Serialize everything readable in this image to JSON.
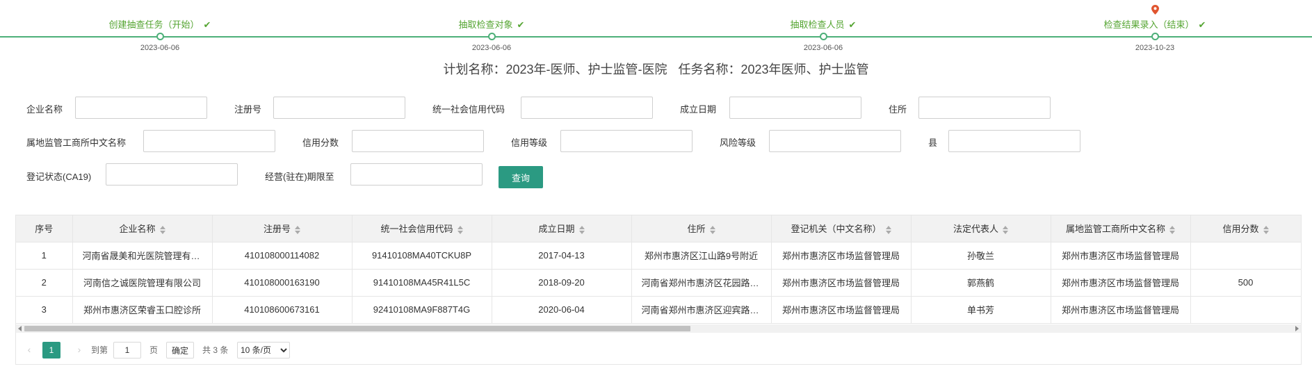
{
  "steps": [
    {
      "title": "创建抽查任务（开始）",
      "date": "2023-06-06"
    },
    {
      "title": "抽取检查对象",
      "date": "2023-06-06"
    },
    {
      "title": "抽取检查人员",
      "date": "2023-06-06"
    },
    {
      "title": "检查结果录入（结束）",
      "date": "2023-10-23"
    }
  ],
  "check_glyph": "✔",
  "plan": {
    "plan_name": "计划名称：2023年-医师、护士监管-医院",
    "task_name": "任务名称：2023年医师、护士监管"
  },
  "filters": {
    "company_name": "企业名称",
    "reg_no": "注册号",
    "credit_code": "统一社会信用代码",
    "established": "成立日期",
    "address": "住所",
    "local_office": "属地监管工商所中文名称",
    "credit_score": "信用分数",
    "credit_level": "信用等级",
    "risk_level": "风险等级",
    "county": "县",
    "reg_status": "登记状态(CA19)",
    "operation_period": "经营(驻在)期限至",
    "query_button": "查询"
  },
  "table": {
    "columns": [
      "序号",
      "企业名称",
      "注册号",
      "统一社会信用代码",
      "成立日期",
      "住所",
      "登记机关（中文名称）",
      "法定代表人",
      "属地监管工商所中文名称",
      "信用分数"
    ],
    "rows": [
      [
        "1",
        "河南省晟美和光医院管理有限公司",
        "410108000114082",
        "91410108MA40TCKU8P",
        "2017-04-13",
        "郑州市惠济区江山路9号附近",
        "郑州市惠济区市场监督管理局",
        "孙敬兰",
        "郑州市惠济区市场监督管理局",
        ""
      ],
      [
        "2",
        "河南信之诚医院管理有限公司",
        "410108000163190",
        "91410108MA45R41L5C",
        "2018-09-20",
        "河南省郑州市惠济区花园路附近",
        "郑州市惠济区市场监督管理局",
        "郭燕鹤",
        "郑州市惠济区市场监督管理局",
        "500"
      ],
      [
        "3",
        "郑州市惠济区荣睿玉口腔诊所",
        "410108600673161",
        "92410108MA9F887T4G",
        "2020-06-04",
        "河南省郑州市惠济区迎宾路附近",
        "郑州市惠济区市场监督管理局",
        "单书芳",
        "郑州市惠济区市场监督管理局",
        ""
      ]
    ]
  },
  "pagination": {
    "prev": "‹",
    "current": "1",
    "next": "›",
    "goto_label": "到第",
    "goto_value": "1",
    "page_unit": "页",
    "confirm": "确定",
    "total": "共 3 条",
    "page_size": "10 条/页"
  }
}
